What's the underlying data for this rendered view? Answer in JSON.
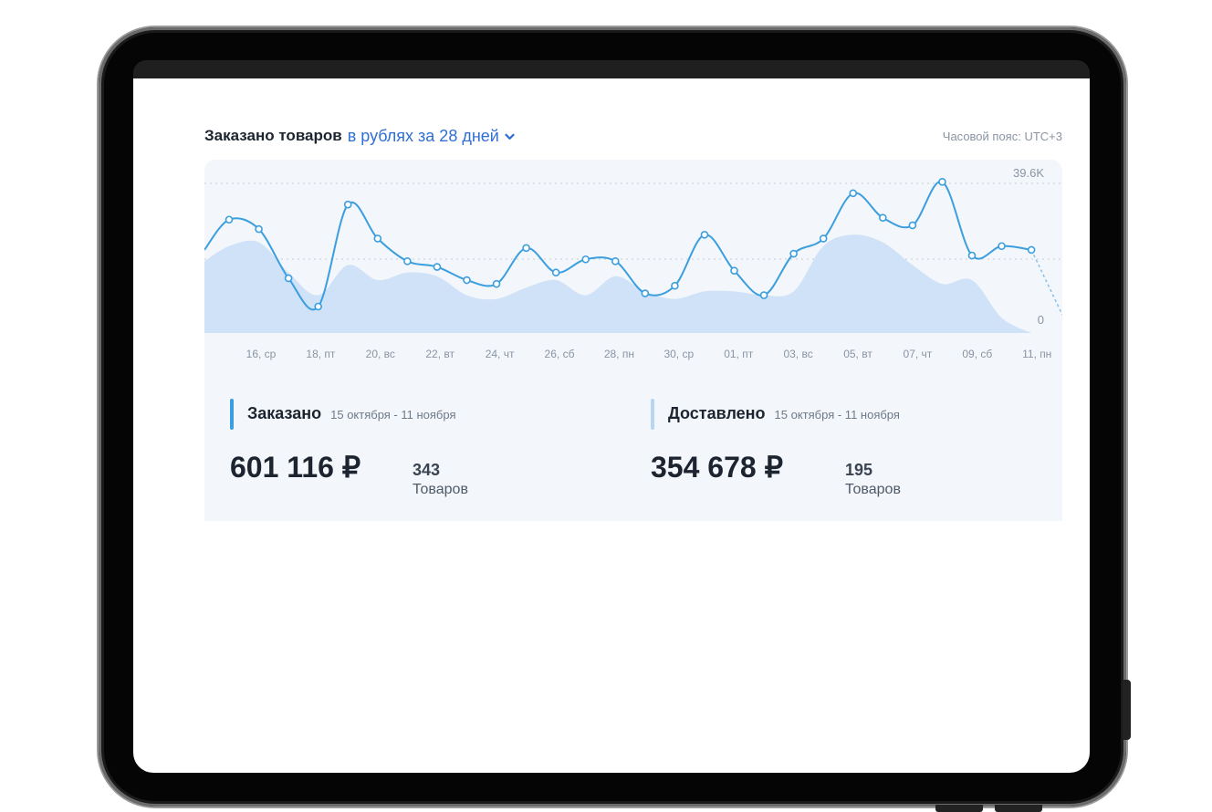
{
  "header": {
    "title": "Заказано товаров",
    "period_link": "в рублях за 28 дней",
    "timezone": "Часовой пояс: UTC+3"
  },
  "chart_data": {
    "type": "line",
    "y_max_label": "39.6K",
    "y_min_label": "0",
    "ylim": [
      0,
      39.6
    ],
    "x_tick_labels": [
      "16, ср",
      "18, пт",
      "20, вс",
      "22, вт",
      "24, чт",
      "26, сб",
      "28, пн",
      "30, ср",
      "01, пт",
      "03, вс",
      "05, вт",
      "07, чт",
      "09, сб",
      "11, пн"
    ],
    "series": [
      {
        "type": "line",
        "color": "#3b9ede",
        "values": [
          30,
          27.5,
          14.5,
          7,
          34,
          25,
          19,
          17.5,
          14,
          13,
          22.5,
          16,
          19.5,
          19,
          10.5,
          12.5,
          26,
          16.5,
          10,
          21,
          25,
          37,
          30.5,
          28.5,
          40,
          20.5,
          23,
          22
        ]
      },
      {
        "type": "area",
        "color": "#cfe2f8",
        "values": [
          23,
          24,
          16,
          10,
          18,
          14,
          16,
          15,
          10,
          9,
          12,
          14,
          10,
          15,
          11,
          9,
          11,
          11,
          10,
          11,
          23,
          26,
          24,
          18,
          13,
          14,
          4,
          0
        ]
      }
    ]
  },
  "stats": {
    "ordered": {
      "label": "Заказано",
      "range": "15 октября - 11 ноября",
      "amount": "601 116 ₽",
      "count": "343",
      "unit": "Товаров",
      "color": "#3b9ede"
    },
    "delivered": {
      "label": "Доставлено",
      "range": "15 октября - 11 ноября",
      "amount": "354 678 ₽",
      "count": "195",
      "unit": "Товаров",
      "color": "#b7d6f1"
    }
  }
}
